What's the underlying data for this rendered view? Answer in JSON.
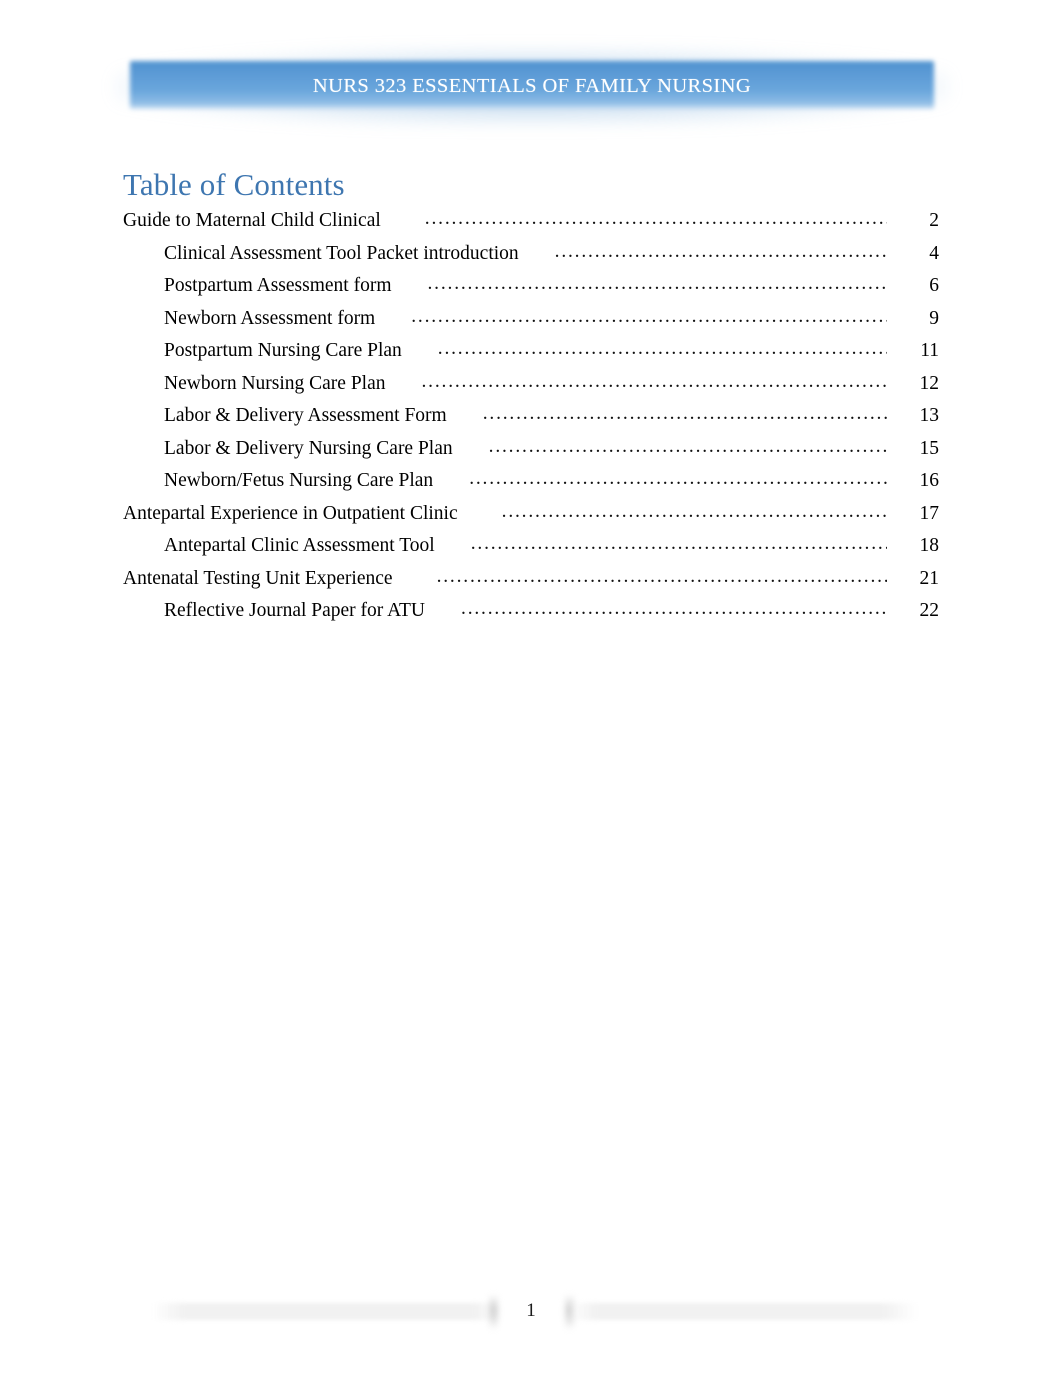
{
  "header": {
    "banner_title": "NURS 323 ESSENTIALS OF FAMILY NURSING",
    "banner_color": "#5b9bd5"
  },
  "page": {
    "title": "Table of Contents",
    "title_color": "#3e76b0",
    "background_color": "#ffffff"
  },
  "toc": {
    "leader": "dotted",
    "entries": [
      {
        "label": "Guide to Maternal Child Clinical",
        "page": "2",
        "level": 1
      },
      {
        "label": "Clinical Assessment Tool Packet introduction",
        "page": "4",
        "level": 2
      },
      {
        "label": "Postpartum Assessment form",
        "page": "6",
        "level": 2
      },
      {
        "label": "Newborn Assessment form",
        "page": "9",
        "level": 2
      },
      {
        "label": "Postpartum Nursing Care Plan",
        "page": "11",
        "level": 2
      },
      {
        "label": "Newborn Nursing Care Plan",
        "page": "12",
        "level": 2
      },
      {
        "label": "Labor & Delivery Assessment Form",
        "page": "13",
        "level": 2
      },
      {
        "label": "Labor & Delivery Nursing Care Plan",
        "page": "15",
        "level": 2
      },
      {
        "label": "Newborn/Fetus Nursing Care Plan",
        "page": "16",
        "level": 2
      },
      {
        "label": "Antepartal Experience in Outpatient Clinic",
        "page": "17",
        "level": 1
      },
      {
        "label": "Antepartal Clinic Assessment Tool",
        "page": "18",
        "level": 2
      },
      {
        "label": "Antenatal Testing Unit Experience",
        "page": "21",
        "level": 1
      },
      {
        "label": "Reflective Journal Paper for ATU",
        "page": "22",
        "level": 2
      }
    ]
  },
  "footer": {
    "page_number": "1",
    "bar_color": "#f1f1f1"
  }
}
